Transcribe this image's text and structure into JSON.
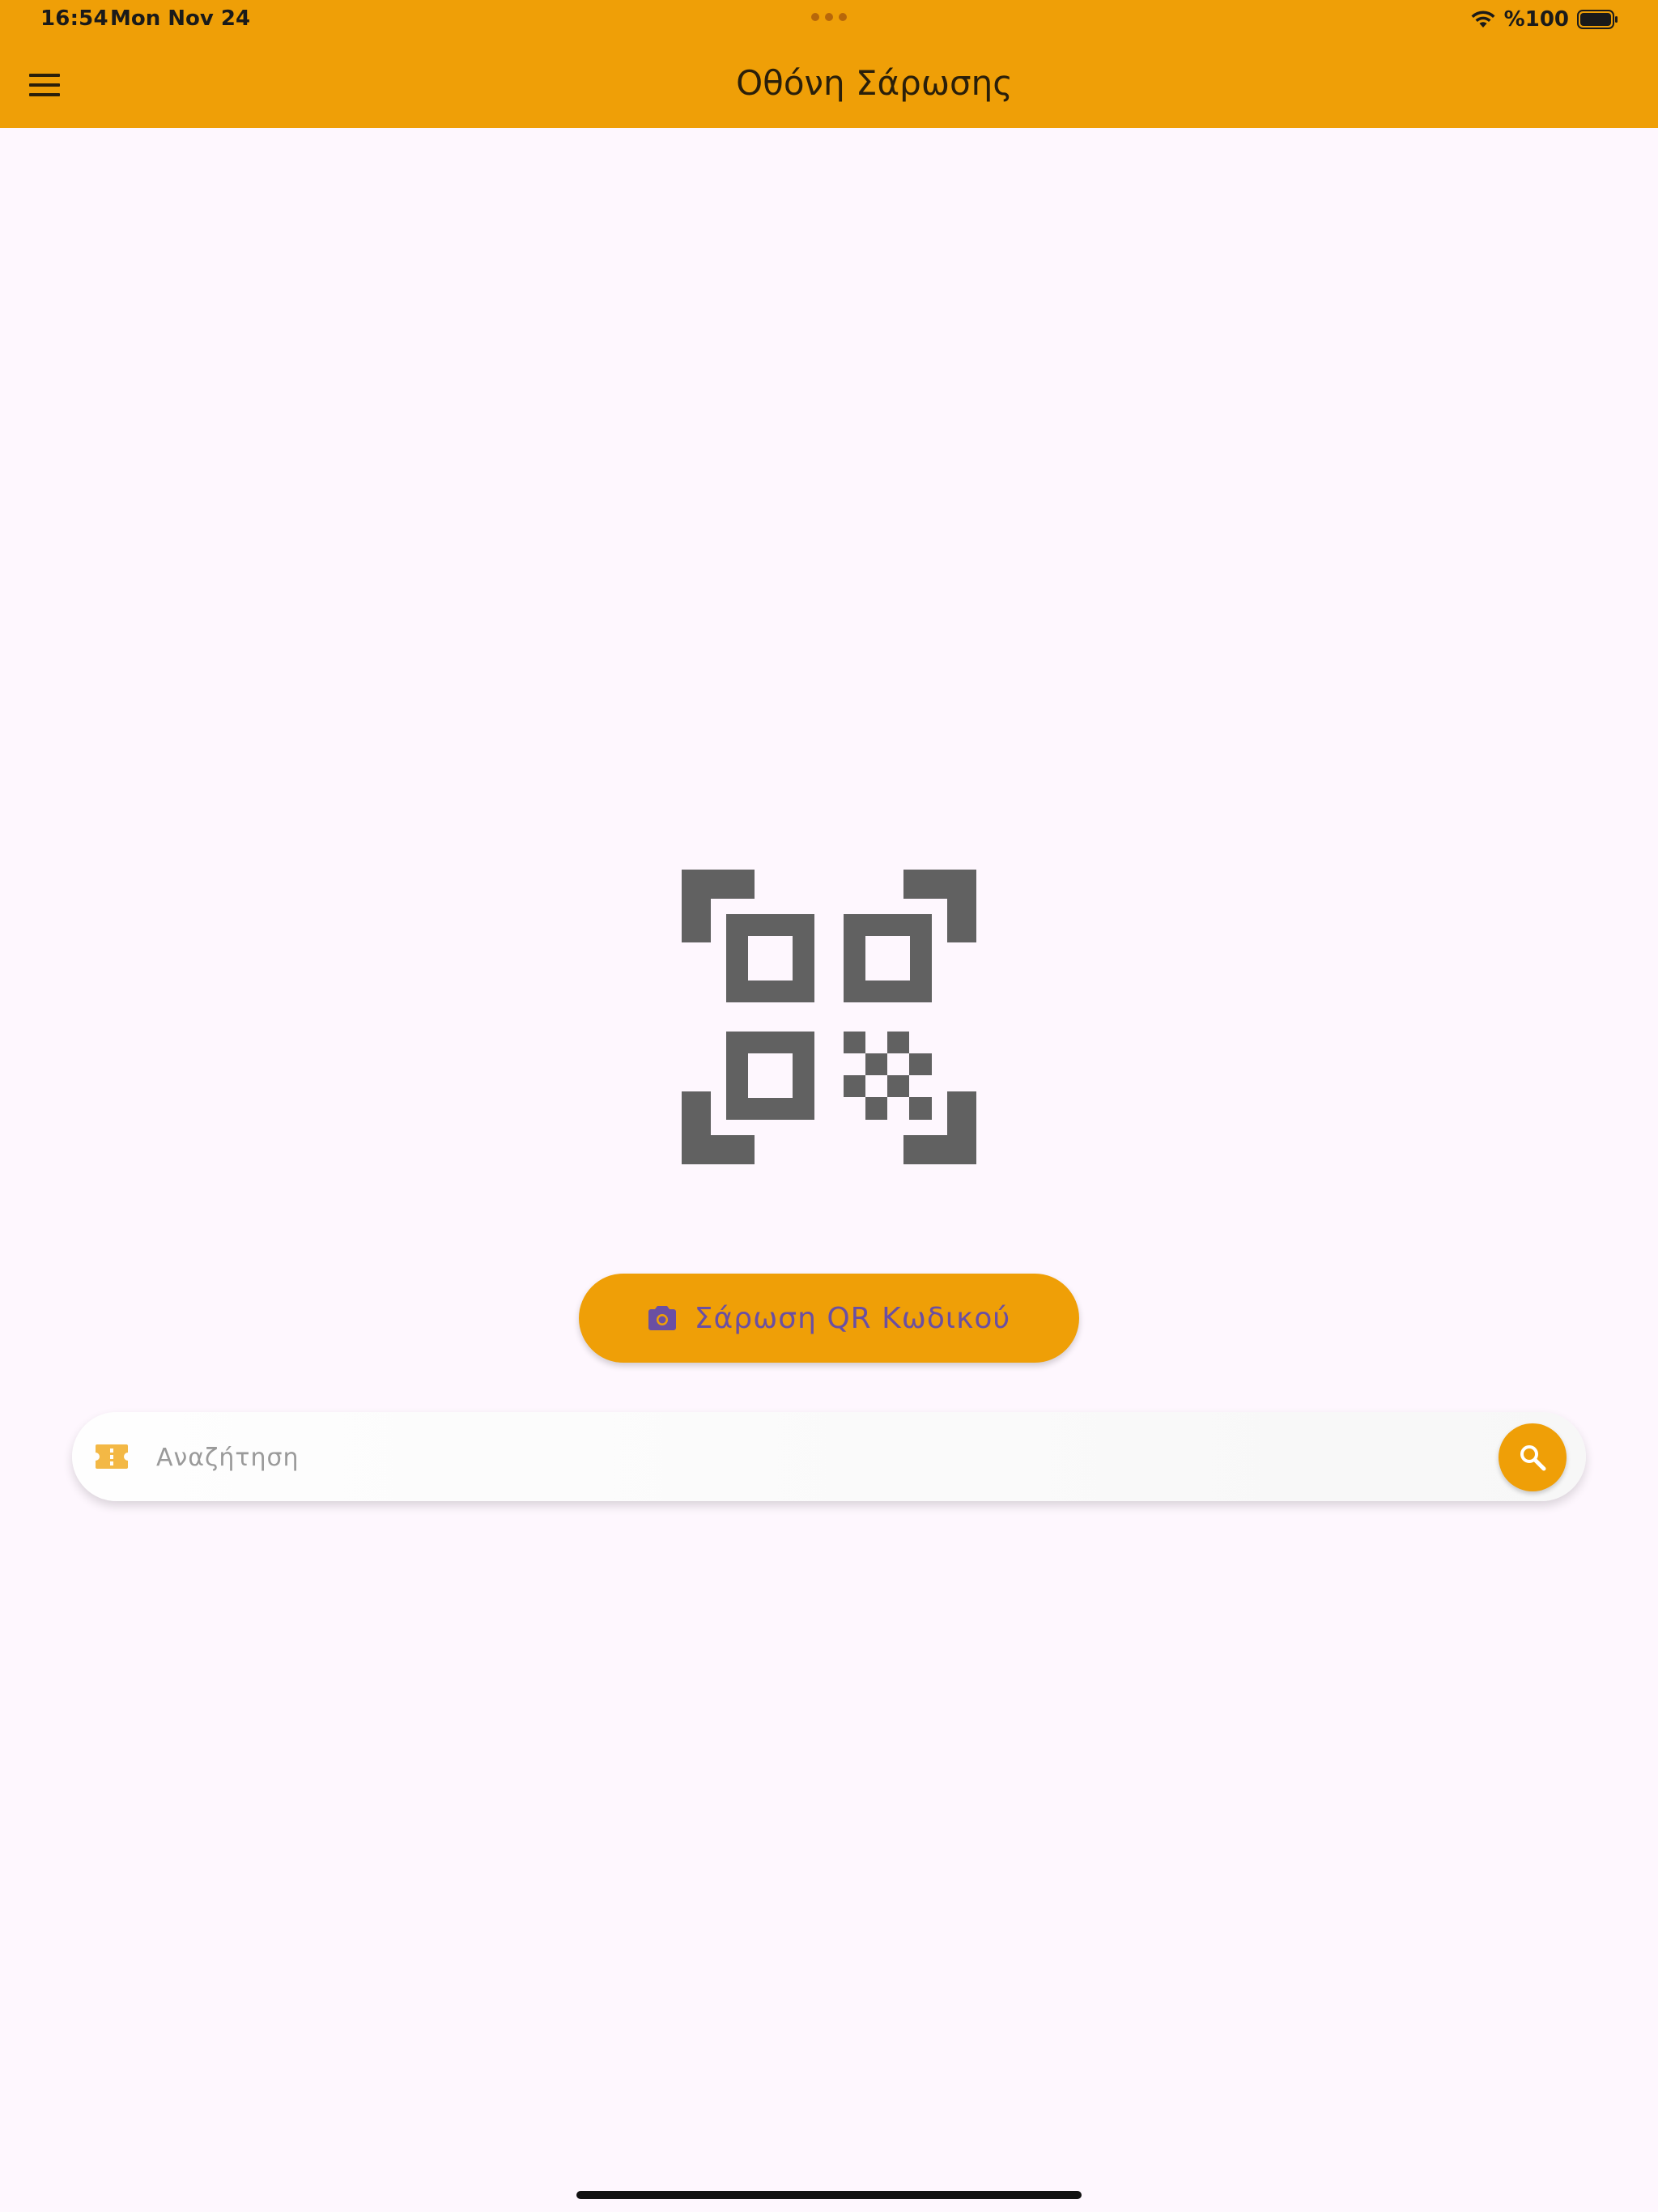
{
  "status_bar": {
    "time": "16:54",
    "date": "Mon Nov 24",
    "battery": "%100"
  },
  "app_bar": {
    "title": "Οθόνη Σάρωσης",
    "menu_icon": "menu-icon"
  },
  "scan": {
    "icon": "qr-code-scanner-icon",
    "button_icon": "camera-icon",
    "button_label": "Σάρωση QR Κωδικού"
  },
  "search": {
    "leading_icon": "ticket-icon",
    "placeholder": "Αναζήτηση",
    "value": "",
    "button_icon": "search-icon"
  },
  "colors": {
    "primary": "#EF9F07",
    "background": "#FEF7FE",
    "button_text": "#6A4FA3",
    "qr_icon": "#616161"
  }
}
